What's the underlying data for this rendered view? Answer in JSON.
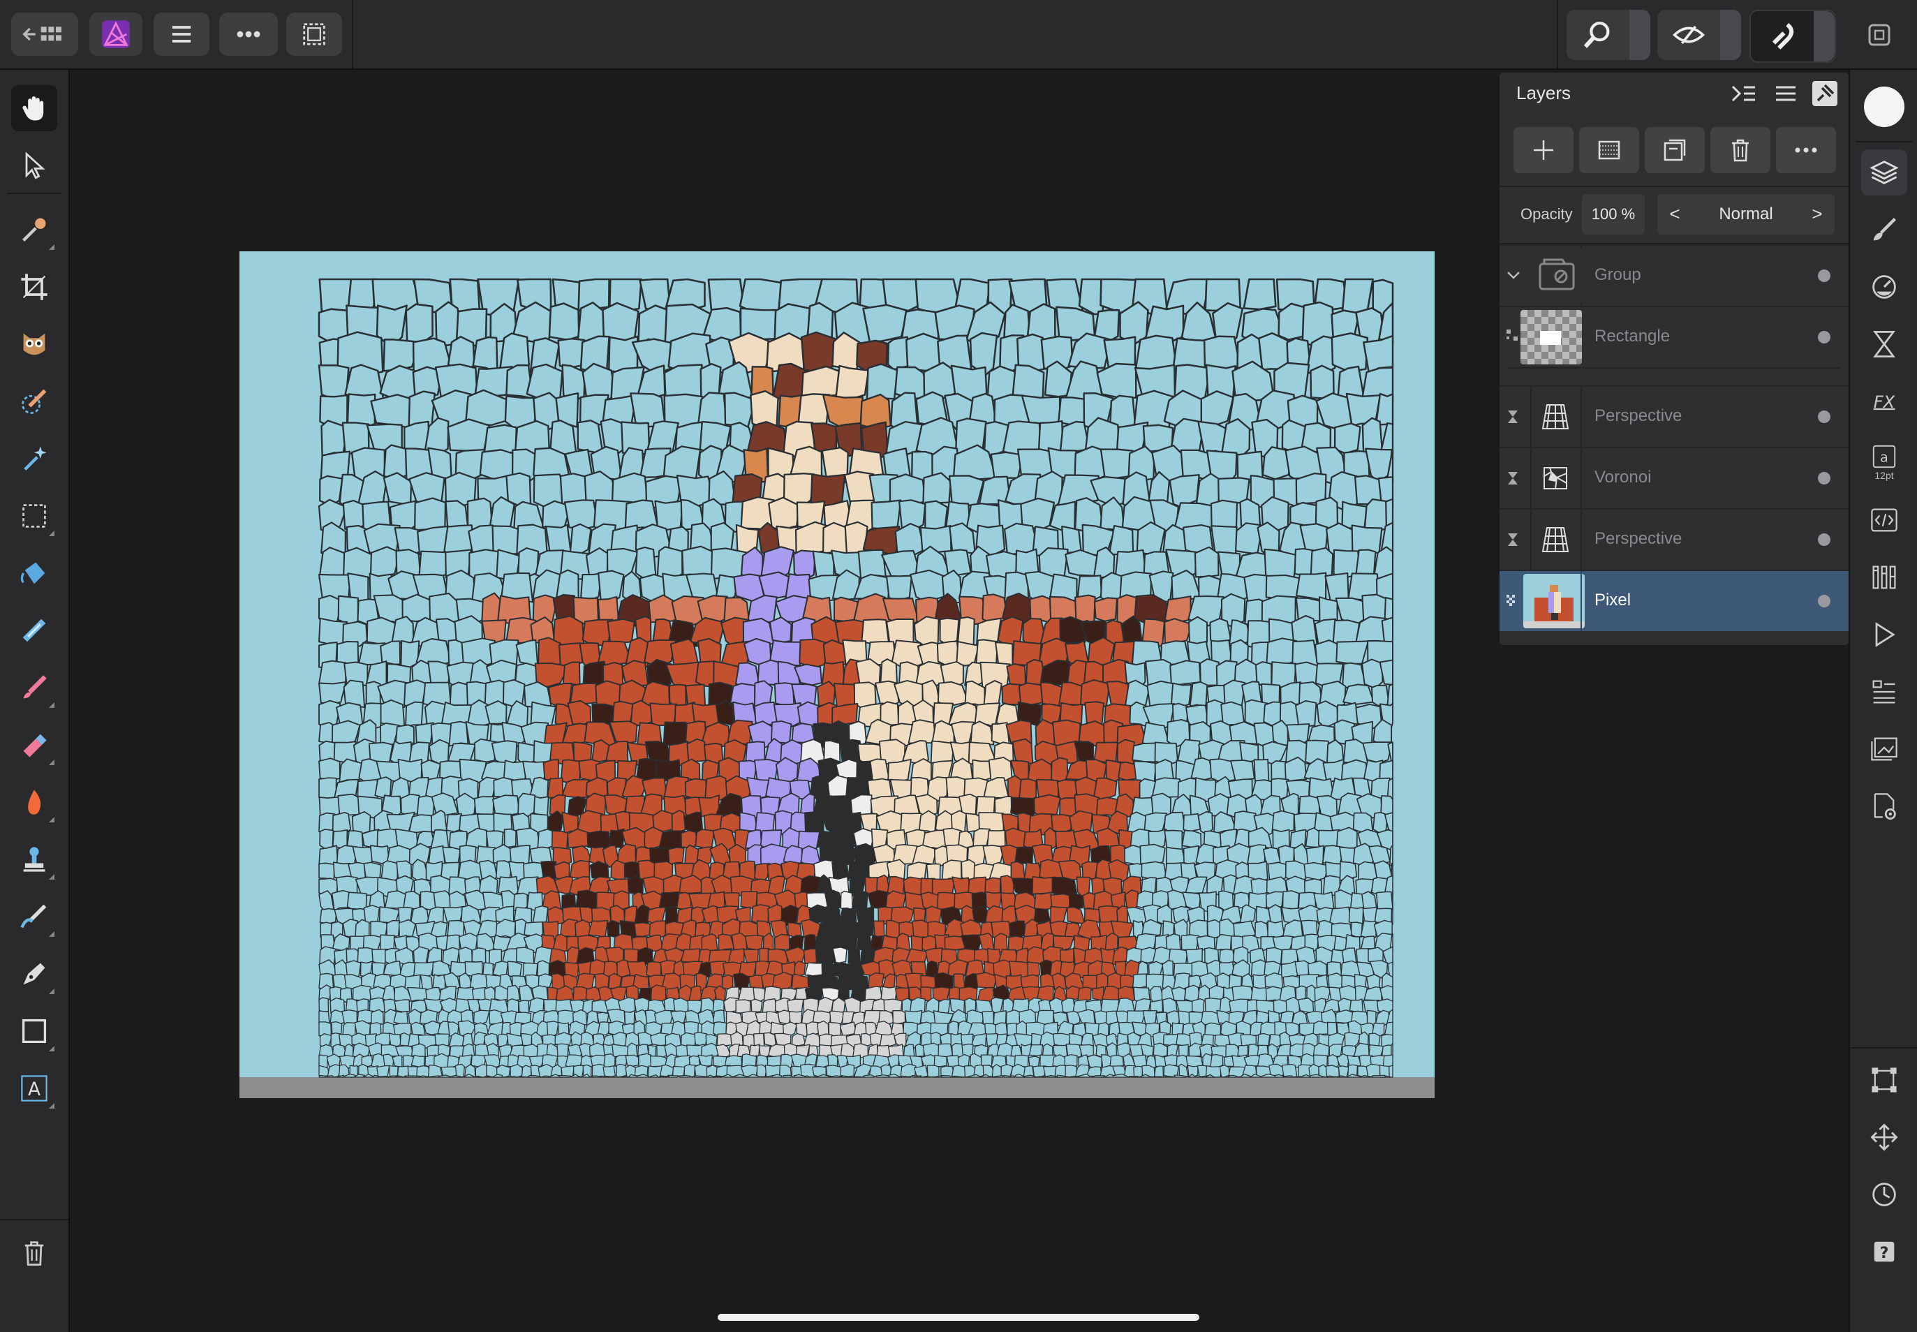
{
  "layers_panel": {
    "title": "Layers",
    "opacity_label": "Opacity",
    "opacity_value": "100 %",
    "blend_mode": "Normal",
    "prev_symbol": "<",
    "next_symbol": ">",
    "layers": [
      {
        "name": "Group",
        "kind": "group",
        "expanded": true
      },
      {
        "name": "Rectangle",
        "kind": "shape"
      },
      {
        "name": "Perspective",
        "kind": "live-filter"
      },
      {
        "name": "Voronoi",
        "kind": "live-filter"
      },
      {
        "name": "Perspective",
        "kind": "live-filter"
      },
      {
        "name": "Pixel",
        "kind": "pixel",
        "selected": true
      }
    ]
  },
  "studio": {
    "text_style_size": "12pt",
    "text_style_glyph": "a",
    "help_glyph": "?",
    "fx_label": "FX"
  },
  "toolbar": {
    "text_tool_glyph": "A"
  },
  "colors": {
    "accent": "#3e5878",
    "canvas_bg": "#9ccfdc",
    "rust": "#c3502f",
    "lavender": "#a99cf0",
    "cream": "#f0dcc0",
    "dark_outline": "#2a2f33"
  }
}
